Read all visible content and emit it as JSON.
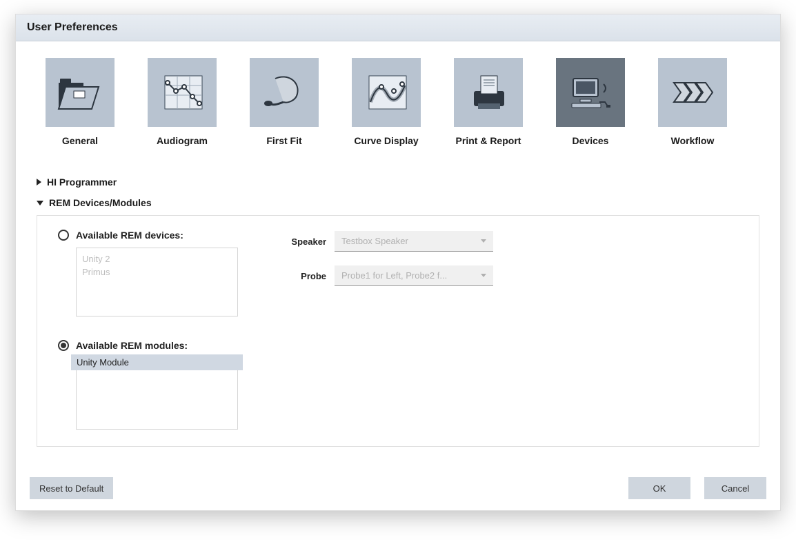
{
  "window": {
    "title": "User Preferences"
  },
  "tabs": {
    "general": "General",
    "audiogram": "Audiogram",
    "firstfit": "First Fit",
    "curve": "Curve Display",
    "print": "Print & Report",
    "devices": "Devices",
    "workflow": "Workflow",
    "active": "devices"
  },
  "sections": {
    "hi_programmer": "HI Programmer",
    "rem_devices": "REM Devices/Modules"
  },
  "rem": {
    "devices_label": "Available REM devices:",
    "modules_label": "Available REM modules:",
    "selected": "modules",
    "devices_list": [
      "Unity 2",
      "Primus"
    ],
    "modules_list": [
      "Unity Module"
    ],
    "speaker": {
      "label": "Speaker",
      "value": "Testbox Speaker"
    },
    "probe": {
      "label": "Probe",
      "value": "Probe1 for Left, Probe2 f..."
    }
  },
  "footer": {
    "reset": "Reset to Default",
    "ok": "OK",
    "cancel": "Cancel"
  }
}
